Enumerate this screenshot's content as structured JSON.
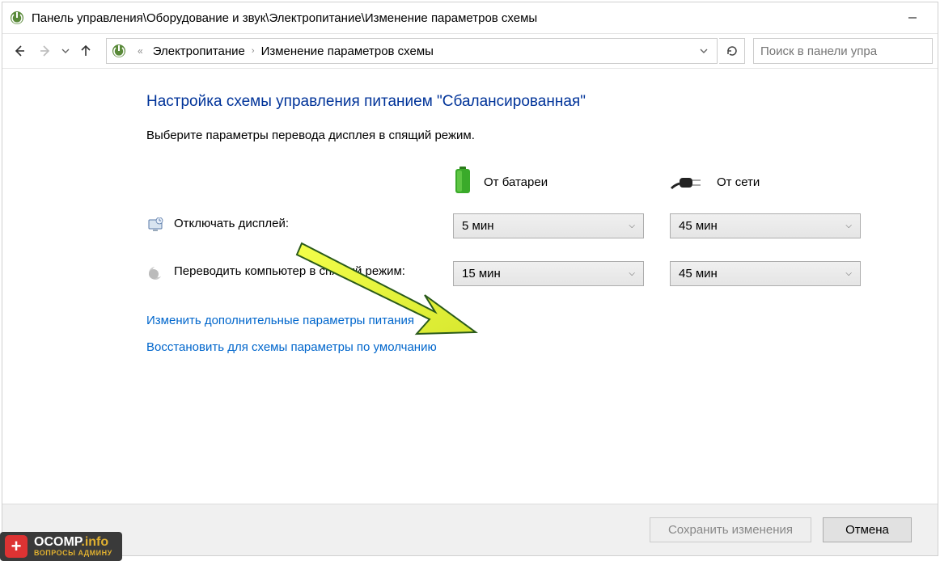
{
  "titlebar": {
    "path": "Панель управления\\Оборудование и звук\\Электропитание\\Изменение параметров схемы"
  },
  "address": {
    "seg1": "Электропитание",
    "seg2": "Изменение параметров схемы"
  },
  "search": {
    "placeholder": "Поиск в панели упра"
  },
  "page": {
    "title": "Настройка схемы управления питанием \"Сбалансированная\"",
    "subtitle": "Выберите параметры перевода дисплея в спящий режим."
  },
  "cols": {
    "battery": "От батареи",
    "plugged": "От сети"
  },
  "rows": {
    "display_off": {
      "label": "Отключать дисплей:",
      "battery": "5 мин",
      "plugged": "45 мин"
    },
    "sleep": {
      "label": "Переводить компьютер в спящий режим:",
      "battery": "15 мин",
      "plugged": "45 мин"
    }
  },
  "links": {
    "advanced": "Изменить дополнительные параметры питания",
    "restore": "Восстановить для схемы параметры по умолчанию"
  },
  "footer": {
    "save": "Сохранить изменения",
    "cancel": "Отмена"
  },
  "watermark": {
    "main": "OCOMP",
    "domain": ".info",
    "sub": "ВОПРОСЫ АДМИНУ"
  }
}
